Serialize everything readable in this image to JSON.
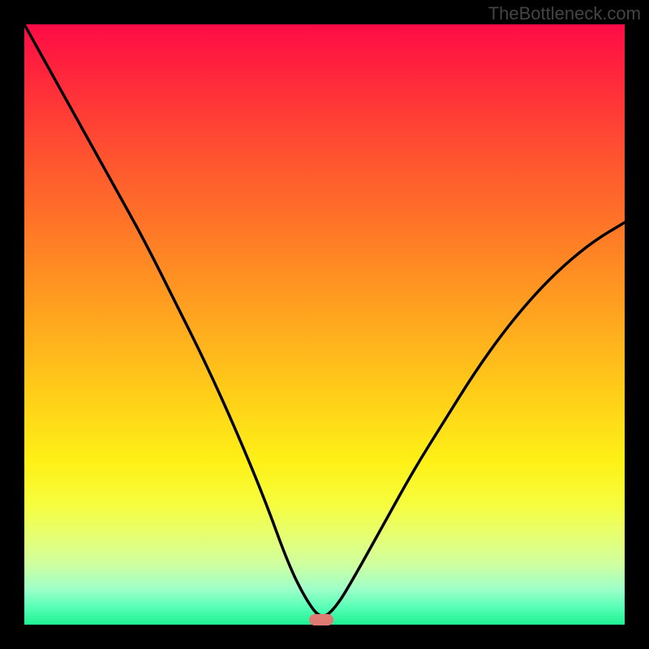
{
  "watermark": "TheBottleneck.com",
  "marker": {
    "x_pct": 49.5,
    "y_pct": 99.0
  },
  "chart_data": {
    "type": "line",
    "title": "",
    "xlabel": "",
    "ylabel": "",
    "xlim": [
      0,
      100
    ],
    "ylim": [
      0,
      100
    ],
    "series": [
      {
        "name": "curve",
        "x": [
          0,
          5,
          10,
          15,
          20,
          25,
          30,
          35,
          40,
          44,
          47,
          49.5,
          52,
          55,
          60,
          65,
          70,
          75,
          80,
          85,
          90,
          95,
          100
        ],
        "y": [
          100,
          91,
          82,
          73,
          64,
          54,
          44,
          33,
          21,
          10,
          4,
          0.8,
          3,
          8,
          17,
          26,
          34,
          42,
          49,
          55,
          60,
          64,
          67
        ]
      }
    ],
    "marker_point": {
      "x": 49.5,
      "y": 0.8,
      "color": "#e07b74"
    }
  }
}
